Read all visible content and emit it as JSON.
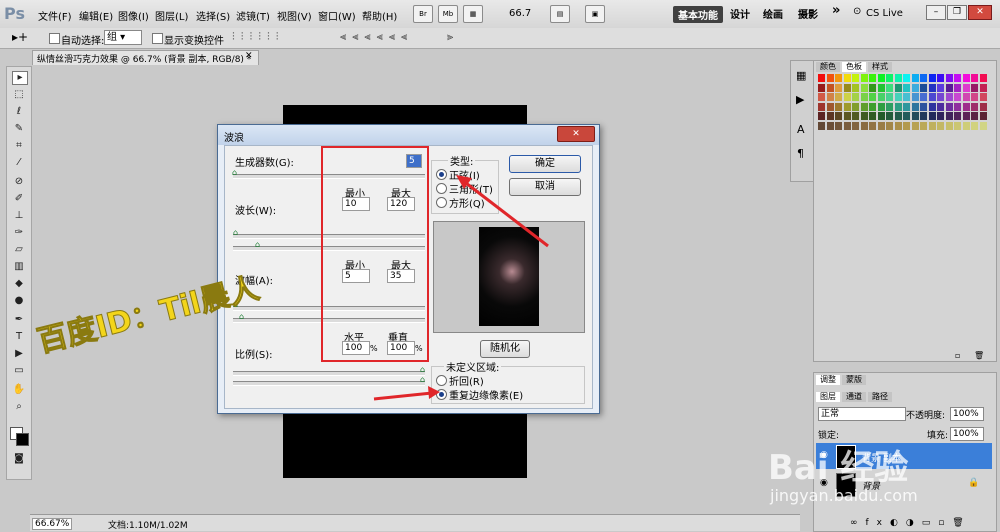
{
  "menubar": {
    "logo": "Ps",
    "items": [
      "文件(F)",
      "编辑(E)",
      "图像(I)",
      "图层(L)",
      "选择(S)",
      "滤镜(T)",
      "视图(V)",
      "窗口(W)",
      "帮助(H)"
    ],
    "bridge_icon": "Br",
    "minibridge_icon": "Mb",
    "zoom": "66.7",
    "workspaces": [
      "基本功能",
      "设计",
      "绘画",
      "摄影"
    ],
    "more": "»",
    "cslive": "CS Live"
  },
  "optionsbar": {
    "auto_select_label": "自动选择:",
    "auto_select_value": "组",
    "show_transform_label": "显示变换控件"
  },
  "document": {
    "tab_title": "纵情丝滑巧克力效果 @ 66.7% (背景 副本, RGB/8) *",
    "zoom_status": "66.67%",
    "doc_info": "文档:1.10M/1.02M"
  },
  "panels": {
    "swatch_tabs": [
      "颜色",
      "色板",
      "样式"
    ],
    "adjust_tabs": [
      "调整",
      "蒙版"
    ],
    "layer_tabs": [
      "图层",
      "通道",
      "路径"
    ],
    "blend_mode": "正常",
    "opacity_label": "不透明度:",
    "opacity_value": "100%",
    "lock_label": "锁定:",
    "fill_label": "填充:",
    "fill_value": "100%",
    "layers": [
      "背景 副本",
      "背景"
    ]
  },
  "dialog": {
    "title": "波浪",
    "generators_label": "生成器数(G):",
    "generators_value": "5",
    "wavelength_label": "波长(W):",
    "amplitude_label": "波幅(A):",
    "scale_label": "比例(S):",
    "min_label": "最小",
    "max_label": "最大",
    "wavelength_min": "10",
    "wavelength_max": "120",
    "amplitude_min": "5",
    "amplitude_max": "35",
    "horizontal_label": "水平",
    "vertical_label": "垂直",
    "scale_h": "100",
    "scale_v": "100",
    "percent": "%",
    "type_label": "类型:",
    "type_options": [
      "正弦(I)",
      "三角形(T)",
      "方形(Q)"
    ],
    "ok": "确定",
    "cancel": "取消",
    "randomize": "随机化",
    "undefined_area_label": "未定义区域:",
    "undefined_options": [
      "折回(R)",
      "重复边缘像素(E)"
    ]
  },
  "watermarks": {
    "baidu_id": "百度ID：Til晨人",
    "baidu_logo": "Bai 经验",
    "baidu_url": "jingyan.baidu.com"
  },
  "colors": {
    "accent_red": "#e0262a",
    "selected_layer": "#3b7fd9",
    "watermark_yellow": "#f3d51a"
  }
}
